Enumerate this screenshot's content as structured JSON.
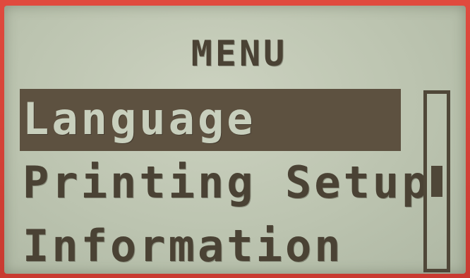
{
  "screen": {
    "title": "MENU"
  },
  "menu": {
    "items": [
      {
        "label": "Language",
        "selected": true
      },
      {
        "label": "Printing Setup",
        "selected": false
      },
      {
        "label": "Information",
        "selected": false
      }
    ]
  },
  "scrollbar": {
    "position_fraction": 0.5
  },
  "colors": {
    "bezel": "#d8382f",
    "lcd_background": "#c3cab6",
    "lcd_text": "#4a4234",
    "highlight": "#5d5140"
  }
}
